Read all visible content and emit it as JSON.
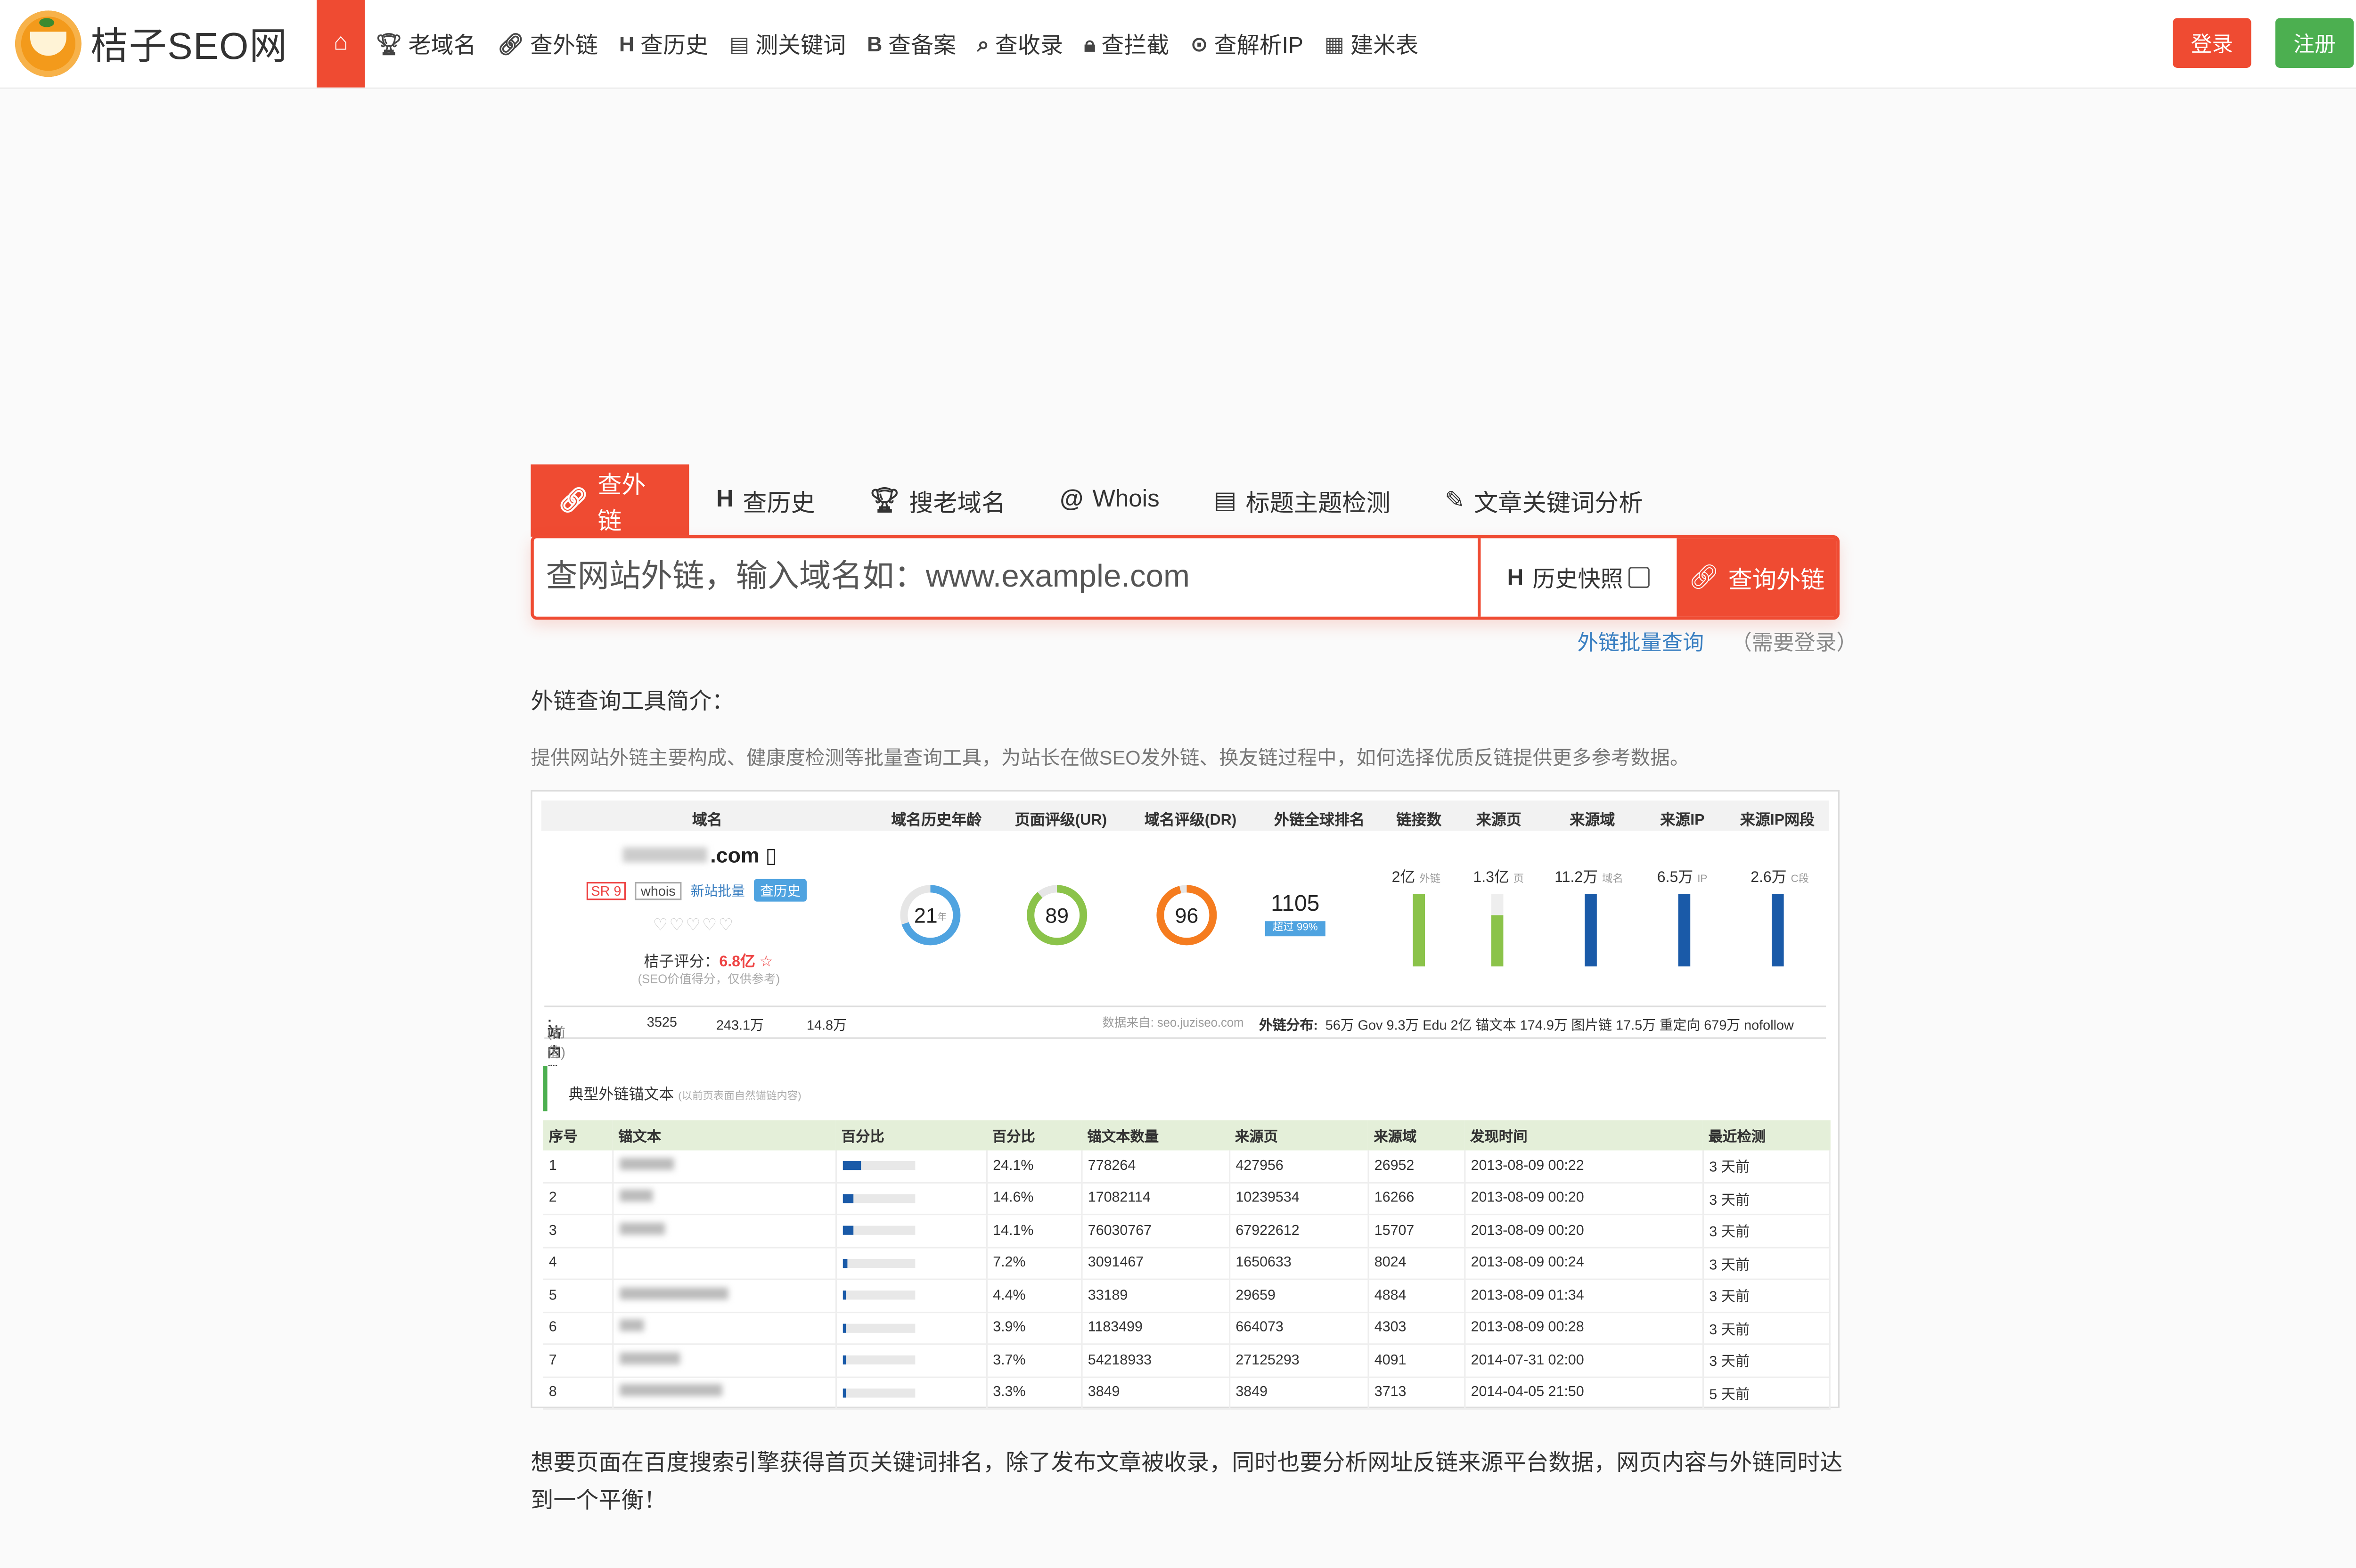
{
  "nav": {
    "logo_text": "桔子SEO网",
    "home_icon": "home-icon",
    "items": [
      {
        "label": "老域名",
        "icon": "trophy-icon"
      },
      {
        "label": "查外链",
        "icon": "link-icon"
      },
      {
        "label": "查历史",
        "icon": "h-icon"
      },
      {
        "label": "测关键词",
        "icon": "document-icon"
      },
      {
        "label": "查备案",
        "icon": "b-icon"
      },
      {
        "label": "查收录",
        "icon": "search-icon"
      },
      {
        "label": "查拦截",
        "icon": "lock-icon"
      },
      {
        "label": "查解析IP",
        "icon": "location-icon"
      },
      {
        "label": "建米表",
        "icon": "list-icon"
      }
    ],
    "login": "登录",
    "register": "注册",
    "brand_color": "#ef4b32",
    "register_color": "#4caf50"
  },
  "tabs": [
    {
      "label": "查外链",
      "icon": "link-icon",
      "active": true
    },
    {
      "label": "查历史",
      "icon": "h-icon"
    },
    {
      "label": "搜老域名",
      "icon": "trophy-icon"
    },
    {
      "label": "Whois",
      "icon": "at-icon"
    },
    {
      "label": "标题主题检测",
      "icon": "document-icon"
    },
    {
      "label": "文章关键词分析",
      "icon": "edit-icon"
    }
  ],
  "search": {
    "placeholder": "查网站外链，输入域名如：www.example.com",
    "history_label": "历史快照",
    "history_checked": false,
    "button": "查询外链"
  },
  "sub_links": {
    "batch": "外链批量查询",
    "note": "（需要登录）"
  },
  "intro": {
    "title": "外链查询工具简介：",
    "desc": "提供网站外链主要构成、健康度检测等批量查询工具，为站长在做SEO发外链、换友链过程中，如何选择优质反链提供更多参考数据。"
  },
  "figure": {
    "headers": [
      "域名",
      "域名历史年龄",
      "页面评级(UR)",
      "域名评级(DR)",
      "外链全球排名",
      "链接数",
      "来源页",
      "来源域",
      "来源IP",
      "来源IP网段"
    ],
    "domain_suffix": ".com",
    "badges": {
      "sr": "SR 9",
      "whois": "whois",
      "new": "新站批量",
      "hist": "查历史"
    },
    "hearts": "♡♡♡♡♡",
    "score_label": "桔子评分：",
    "score_value": "6.8亿",
    "score_note": "(SEO价值得分，仅供参考)",
    "rings": [
      {
        "value": "21",
        "unit": "年",
        "pct": 0.7,
        "color": "#4fa3e0"
      },
      {
        "value": "89",
        "pct": 0.89,
        "color": "#8bc34a"
      },
      {
        "value": "96",
        "pct": 0.96,
        "color": "#f57c1f"
      }
    ],
    "rank": {
      "value": "1105",
      "tag": "超过 99%"
    },
    "bars": [
      {
        "value": "2亿",
        "unit": "外链",
        "pct": 1.0,
        "color": "#8bc34a"
      },
      {
        "value": "1.3亿",
        "unit": "页",
        "pct": 0.7,
        "color": "#8bc34a"
      },
      {
        "value": "11.2万",
        "unit": "域名",
        "pct": 1.0,
        "color": "#1a5aa8"
      },
      {
        "value": "6.5万",
        "unit": "IP",
        "pct": 1.0,
        "color": "#1a5aa8"
      },
      {
        "value": "2.6万",
        "unit": "C段",
        "pct": 1.0,
        "color": "#1a5aa8"
      }
    ],
    "site_row": {
      "label": "站内数据",
      "label_note": "(前值)",
      "v1": "3525",
      "v2": "243.1万",
      "v3": "14.8万",
      "source": "数据来自: seo.juziseo.com",
      "dist_label": "外链分布:",
      "dist": "56万 Gov   9.3万 Edu   2亿 锚文本   174.9万 图片链   17.5万 重定向   679万 nofollow"
    },
    "anchor_title": "典型外链锚文本",
    "anchor_note": "(以前页表面自然锚链内容)",
    "table": {
      "columns": [
        "序号",
        "锚文本",
        "百分比",
        "百分比",
        "锚文本数量",
        "来源页",
        "来源域",
        "发现时间",
        "最近检测"
      ],
      "rows": [
        {
          "no": "1",
          "bar": 0.24,
          "pct": "24.1%",
          "count": "778264",
          "pages": "427956",
          "domains": "26952",
          "found": "2013-08-09 00:22",
          "check": "3 天前"
        },
        {
          "no": "2",
          "bar": 0.146,
          "pct": "14.6%",
          "count": "17082114",
          "pages": "10239534",
          "domains": "16266",
          "found": "2013-08-09 00:20",
          "check": "3 天前"
        },
        {
          "no": "3",
          "bar": 0.141,
          "pct": "14.1%",
          "count": "76030767",
          "pages": "67922612",
          "domains": "15707",
          "found": "2013-08-09 00:20",
          "check": "3 天前"
        },
        {
          "no": "4",
          "bar": 0.072,
          "pct": "7.2%",
          "count": "3091467",
          "pages": "1650633",
          "domains": "8024",
          "found": "2013-08-09 00:24",
          "check": "3 天前"
        },
        {
          "no": "5",
          "bar": 0.044,
          "pct": "4.4%",
          "count": "33189",
          "pages": "29659",
          "domains": "4884",
          "found": "2013-08-09 01:34",
          "check": "3 天前"
        },
        {
          "no": "6",
          "bar": 0.039,
          "pct": "3.9%",
          "count": "1183499",
          "pages": "664073",
          "domains": "4303",
          "found": "2013-08-09 00:28",
          "check": "3 天前"
        },
        {
          "no": "7",
          "bar": 0.037,
          "pct": "3.7%",
          "count": "54218933",
          "pages": "27125293",
          "domains": "4091",
          "found": "2014-07-31 02:00",
          "check": "3 天前"
        },
        {
          "no": "8",
          "bar": 0.033,
          "pct": "3.3%",
          "count": "3849",
          "pages": "3849",
          "domains": "3713",
          "found": "2014-04-05 21:50",
          "check": "5 天前"
        }
      ]
    }
  },
  "footer_paragraph": "想要页面在百度搜索引擎获得首页关键词排名，除了发布文章被收录，同时也要分析网址反链来源平台数据，网页内容与外链同时达到一个平衡！"
}
